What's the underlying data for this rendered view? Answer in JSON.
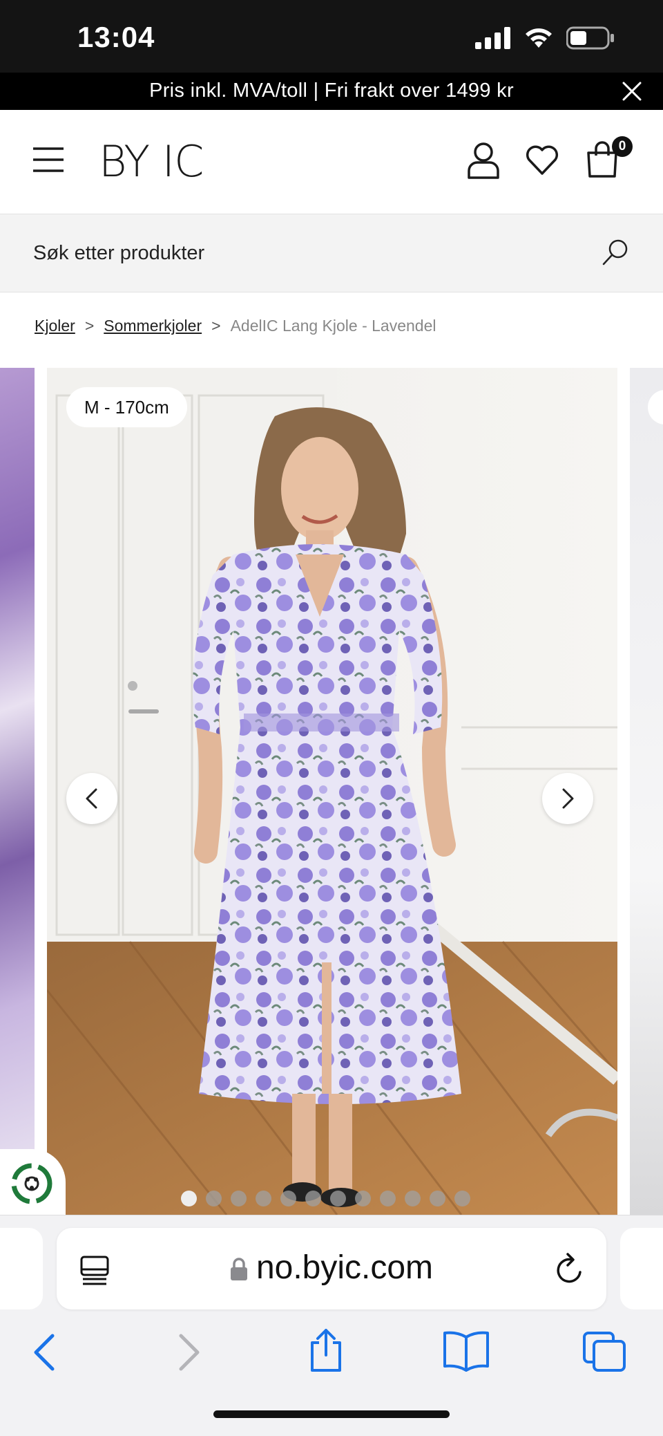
{
  "status_bar": {
    "time": "13:04",
    "battery_level": 0.45
  },
  "promo": {
    "text": "Pris inkl. MVA/toll | Fri frakt over 1499 kr",
    "close_icon": "close-icon"
  },
  "header": {
    "logo": "BY IC",
    "menu_icon": "hamburger-menu-icon",
    "user_icon": "user-icon",
    "heart_icon": "heart-icon",
    "bag_icon": "shopping-bag-icon",
    "cart_count": "0"
  },
  "search": {
    "placeholder": "Søk etter produkter",
    "icon": "search-icon"
  },
  "breadcrumb": {
    "items": [
      "Kjoler",
      "Sommerkjoler"
    ],
    "separator": ">",
    "current": "AdelIC Lang Kjole - Lavendel"
  },
  "gallery": {
    "size_tag": "M - 170cm",
    "slide_count": 12,
    "active_slide": 1,
    "prev_icon": "chevron-left-icon",
    "next_icon": "chevron-right-icon",
    "eco_icon": "recycle-icon"
  },
  "safari": {
    "url": "no.byic.com",
    "lock_icon": "lock-icon",
    "reload_icon": "reload-icon",
    "tab_icon": "page-tabs-icon",
    "toolbar": [
      "back-icon",
      "forward-icon",
      "share-icon",
      "bookmarks-icon",
      "tabs-icon"
    ]
  },
  "colors": {
    "accent_blue": "#1a73e8",
    "dress_lavender": "#8f7fd6",
    "banner_black": "#000000"
  }
}
